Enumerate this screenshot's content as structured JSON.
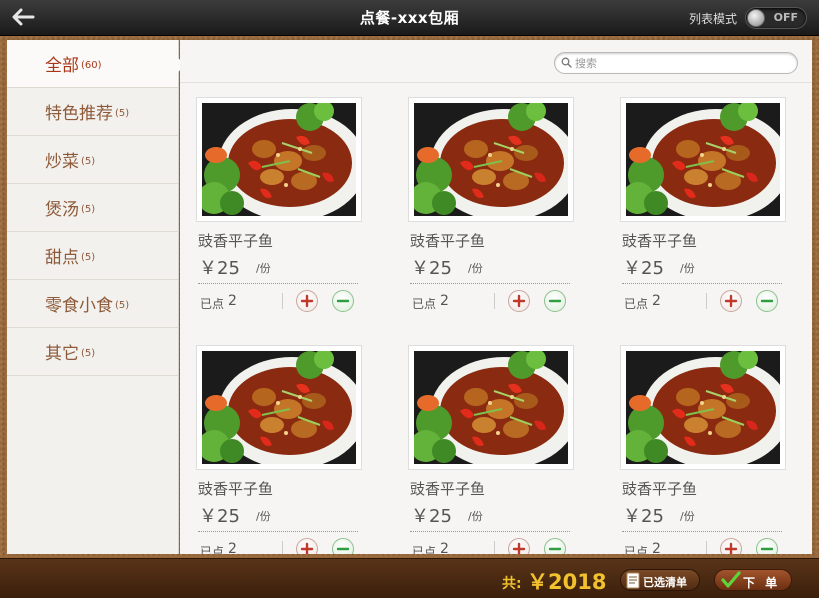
{
  "header": {
    "back_icon": "arrow-left-icon",
    "title": "点餐-xxx包厢",
    "mode_label": "列表模式",
    "toggle_state": "OFF"
  },
  "sidebar": {
    "categories": [
      {
        "name": "全部",
        "count": "(60)",
        "active": true
      },
      {
        "name": "特色推荐",
        "count": "(5)",
        "active": false
      },
      {
        "name": "炒菜",
        "count": "(5)",
        "active": false
      },
      {
        "name": "煲汤",
        "count": "(5)",
        "active": false
      },
      {
        "name": "甜点",
        "count": "(5)",
        "active": false
      },
      {
        "name": "零食小食",
        "count": "(5)",
        "active": false
      },
      {
        "name": "其它",
        "count": "(5)",
        "active": false
      }
    ]
  },
  "search": {
    "placeholder": "搜索",
    "value": "",
    "icon": "search-icon"
  },
  "dishes": [
    {
      "name": "豉香平子鱼",
      "price": "￥25",
      "unit": "/份",
      "ordered_label": "已点",
      "ordered_count": "2"
    },
    {
      "name": "豉香平子鱼",
      "price": "￥25",
      "unit": "/份",
      "ordered_label": "已点",
      "ordered_count": "2"
    },
    {
      "name": "豉香平子鱼",
      "price": "￥25",
      "unit": "/份",
      "ordered_label": "已点",
      "ordered_count": "2"
    },
    {
      "name": "豉香平子鱼",
      "price": "￥25",
      "unit": "/份",
      "ordered_label": "已点",
      "ordered_count": "2"
    },
    {
      "name": "豉香平子鱼",
      "price": "￥25",
      "unit": "/份",
      "ordered_label": "已点",
      "ordered_count": "2"
    },
    {
      "name": "豉香平子鱼",
      "price": "￥25",
      "unit": "/份",
      "ordered_label": "已点",
      "ordered_count": "2"
    }
  ],
  "footer": {
    "total_label": "共:",
    "total_value": "￥2018",
    "selected_list_label": "已选清单",
    "order_label": "下 单"
  },
  "colors": {
    "accent_red": "#a8381b",
    "category_text": "#8d5a3a",
    "total_yellow": "#f2c12e",
    "plus_red": "#c0392b",
    "minus_green": "#2e9e3e"
  }
}
